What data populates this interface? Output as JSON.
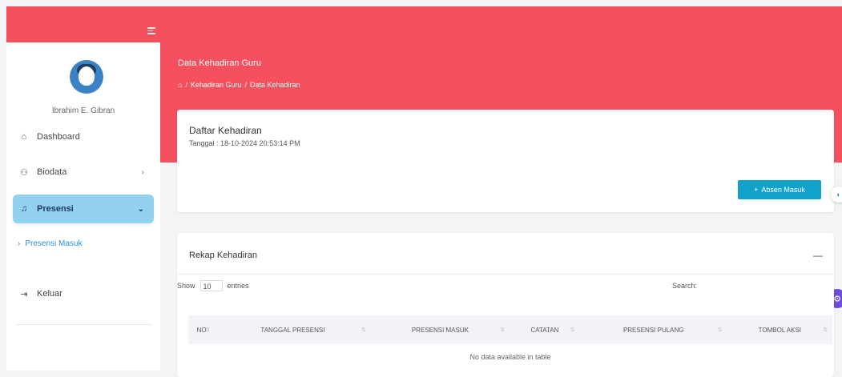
{
  "sidebar": {
    "username": "Ibrahim E. Gibran",
    "items": [
      {
        "label": "Dashboard",
        "icon": "home-icon"
      },
      {
        "label": "Biodata",
        "icon": "user-icon"
      },
      {
        "label": "Presensi",
        "icon": "bell-icon"
      }
    ],
    "submenu": {
      "label": "Presensi Masuk"
    },
    "logout": {
      "label": "Keluar",
      "icon": "logout-icon"
    }
  },
  "header": {
    "title": "Data Kehadiran Guru",
    "breadcrumb": [
      "Kehadiran Guru",
      "Data Kehadiran"
    ]
  },
  "attendance_card": {
    "title": "Daftar Kehadiran",
    "date": "Tanggal : 18-10-2024 20:53:14 PM",
    "button_label": "Absen Masuk"
  },
  "recap_card": {
    "title": "Rekap Kehadiran",
    "show_label": "Show",
    "entries_value": "10",
    "entries_label": "entries",
    "search_label": "Search:",
    "columns": [
      "NO",
      "TANGGAL PRESENSI",
      "PRESENSI MASUK",
      "CATATAN",
      "PRESENSI PULANG",
      "TOMBOL AKSI"
    ],
    "empty_message": "No data available in table"
  },
  "colors": {
    "brand_red": "#f4505e",
    "active_nav": "#93d1f2",
    "button_teal": "#12a2c9"
  }
}
